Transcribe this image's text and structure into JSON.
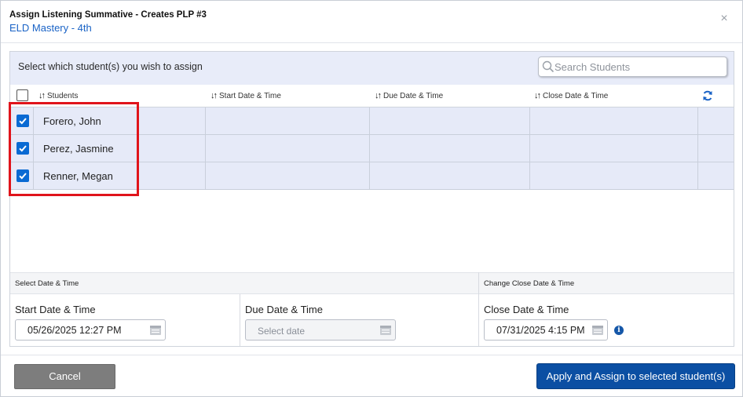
{
  "dialog": {
    "title": "Assign Listening Summative - Creates PLP #3",
    "subtitle": "ELD Mastery - 4th"
  },
  "panel": {
    "instruction": "Select which student(s) you wish to assign",
    "search_placeholder": "Search Students"
  },
  "table": {
    "columns": [
      "Students",
      "Start Date & Time",
      "Due Date & Time",
      "Close Date & Time"
    ],
    "rows": [
      {
        "name": "Forero, John",
        "checked": true
      },
      {
        "name": "Perez, Jasmine",
        "checked": true
      },
      {
        "name": "Renner, Megan",
        "checked": true
      }
    ]
  },
  "dates": {
    "section_left": "Select Date & Time",
    "section_right": "Change Close Date & Time",
    "start_label": "Start Date & Time",
    "start_value": "05/26/2025 12:27 PM",
    "due_label": "Due Date & Time",
    "due_placeholder": "Select date",
    "close_label": "Close Date & Time",
    "close_value": "07/31/2025 4:15 PM"
  },
  "footer": {
    "cancel_label": "Cancel",
    "apply_label": "Apply and Assign to selected student(s)"
  },
  "colors": {
    "accent": "#0b4fa3",
    "highlight": "#e0141b",
    "row_bg": "#e6eaf8"
  }
}
